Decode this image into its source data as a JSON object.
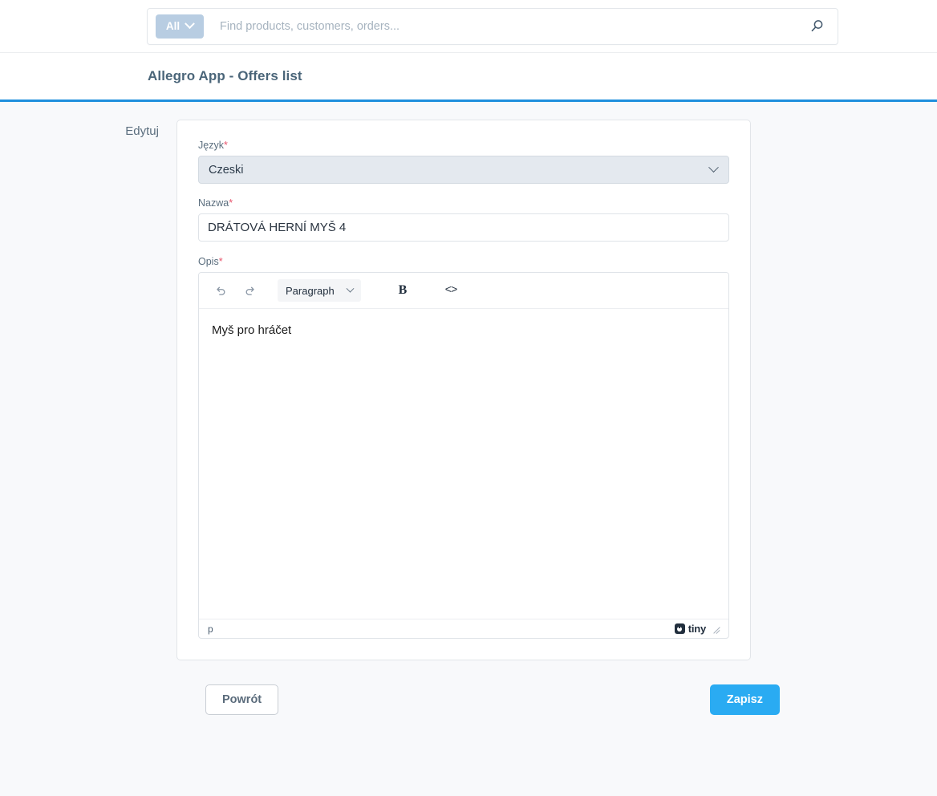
{
  "search": {
    "scope_label": "All",
    "scope_icon": "chevron-down-icon",
    "placeholder": "Find products, customers, orders...",
    "value": "",
    "search_icon": "search-icon"
  },
  "header": {
    "title": "Allegro App - Offers list",
    "accent_color": "#1f8fdd"
  },
  "form": {
    "section_label": "Edytuj",
    "language": {
      "label": "Język",
      "required_mark": "*",
      "value": "Czeski",
      "caret_icon": "chevron-down-icon"
    },
    "name": {
      "label": "Nazwa",
      "required_mark": "*",
      "value": "DRÁTOVÁ HERNÍ MYŠ 4"
    },
    "description": {
      "label": "Opis",
      "required_mark": "*",
      "toolbar": {
        "undo_icon": "undo-icon",
        "redo_icon": "redo-icon",
        "block_format": "Paragraph",
        "block_caret_icon": "chevron-down-icon",
        "bold_label": "B",
        "code_label": "<>"
      },
      "content": "Myš pro hráčet",
      "status_path": "p",
      "brand_label": "tiny",
      "brand_icon": "tinymce-logo-icon",
      "resize_icon": "resize-grip-icon"
    }
  },
  "footer": {
    "back_label": "Powrót",
    "save_label": "Zapisz",
    "save_color": "#2aabf2"
  }
}
